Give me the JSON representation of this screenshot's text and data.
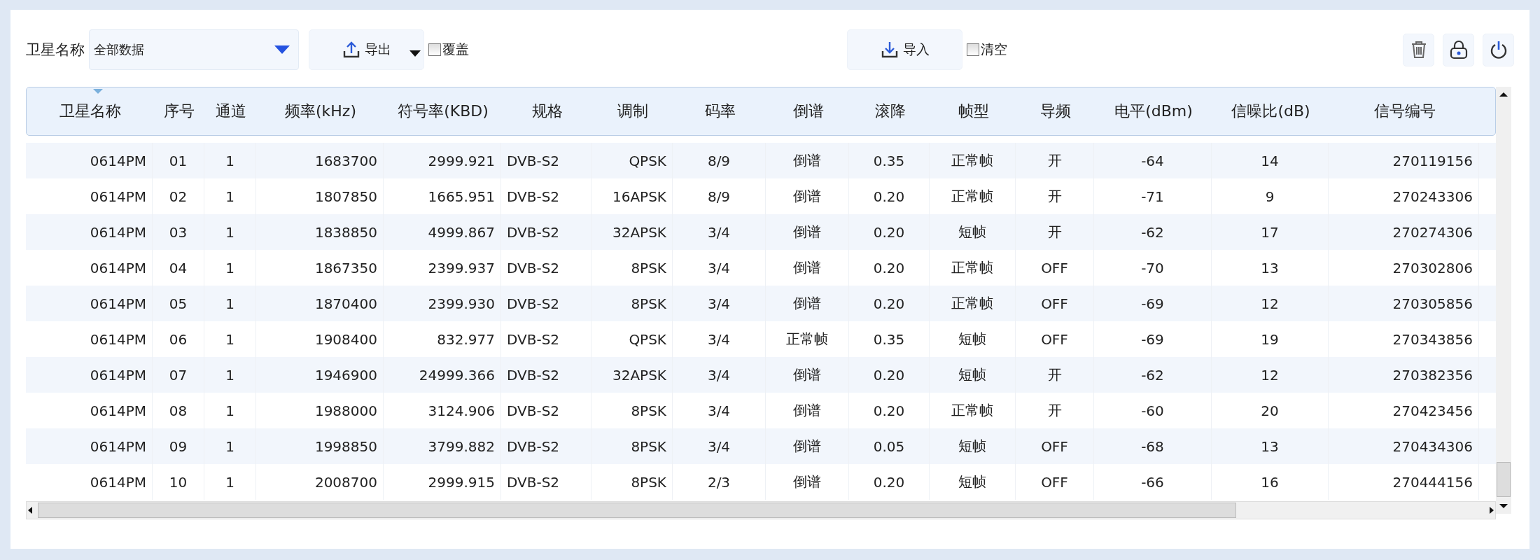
{
  "toolbar": {
    "satellite_label": "卫星名称",
    "satellite_select": {
      "value": "全部数据"
    },
    "export_button": "导出",
    "overwrite": {
      "label": "覆盖",
      "checked": false
    },
    "import_button": "导入",
    "clear": {
      "label": "清空",
      "checked": false
    }
  },
  "table": {
    "columns": [
      {
        "label": "卫星名称"
      },
      {
        "label": "序号"
      },
      {
        "label": "通道"
      },
      {
        "label": "频率(kHz)"
      },
      {
        "label": "符号率(KBD)"
      },
      {
        "label": "规格"
      },
      {
        "label": "调制"
      },
      {
        "label": "码率"
      },
      {
        "label": "倒谱"
      },
      {
        "label": "滚降"
      },
      {
        "label": "帧型"
      },
      {
        "label": "导频"
      },
      {
        "label": "电平(dBm)"
      },
      {
        "label": "信噪比(dB)"
      },
      {
        "label": "信号编号"
      }
    ],
    "rows": [
      [
        "0614PM",
        "01",
        "1",
        "1683700",
        "2999.921",
        "DVB-S2",
        "QPSK",
        "8/9",
        "倒谱",
        "0.35",
        "正常帧",
        "开",
        "-64",
        "14",
        "270119156"
      ],
      [
        "0614PM",
        "02",
        "1",
        "1807850",
        "1665.951",
        "DVB-S2",
        "16APSK",
        "8/9",
        "倒谱",
        "0.20",
        "正常帧",
        "开",
        "-71",
        "9",
        "270243306"
      ],
      [
        "0614PM",
        "03",
        "1",
        "1838850",
        "4999.867",
        "DVB-S2",
        "32APSK",
        "3/4",
        "倒谱",
        "0.20",
        "短帧",
        "开",
        "-62",
        "17",
        "270274306"
      ],
      [
        "0614PM",
        "04",
        "1",
        "1867350",
        "2399.937",
        "DVB-S2",
        "8PSK",
        "3/4",
        "倒谱",
        "0.20",
        "正常帧",
        "OFF",
        "-70",
        "13",
        "270302806"
      ],
      [
        "0614PM",
        "05",
        "1",
        "1870400",
        "2399.930",
        "DVB-S2",
        "8PSK",
        "3/4",
        "倒谱",
        "0.20",
        "正常帧",
        "OFF",
        "-69",
        "12",
        "270305856"
      ],
      [
        "0614PM",
        "06",
        "1",
        "1908400",
        "832.977",
        "DVB-S2",
        "QPSK",
        "3/4",
        "正常帧",
        "0.35",
        "短帧",
        "OFF",
        "-69",
        "19",
        "270343856"
      ],
      [
        "0614PM",
        "07",
        "1",
        "1946900",
        "24999.366",
        "DVB-S2",
        "32APSK",
        "3/4",
        "倒谱",
        "0.20",
        "短帧",
        "开",
        "-62",
        "12",
        "270382356"
      ],
      [
        "0614PM",
        "08",
        "1",
        "1988000",
        "3124.906",
        "DVB-S2",
        "8PSK",
        "3/4",
        "倒谱",
        "0.20",
        "正常帧",
        "开",
        "-60",
        "20",
        "270423456"
      ],
      [
        "0614PM",
        "09",
        "1",
        "1998850",
        "3799.882",
        "DVB-S2",
        "8PSK",
        "3/4",
        "倒谱",
        "0.05",
        "短帧",
        "OFF",
        "-68",
        "13",
        "270434306"
      ],
      [
        "0614PM",
        "10",
        "1",
        "2008700",
        "2999.915",
        "DVB-S2",
        "8PSK",
        "2/3",
        "倒谱",
        "0.20",
        "短帧",
        "OFF",
        "-66",
        "16",
        "270444156"
      ]
    ]
  }
}
